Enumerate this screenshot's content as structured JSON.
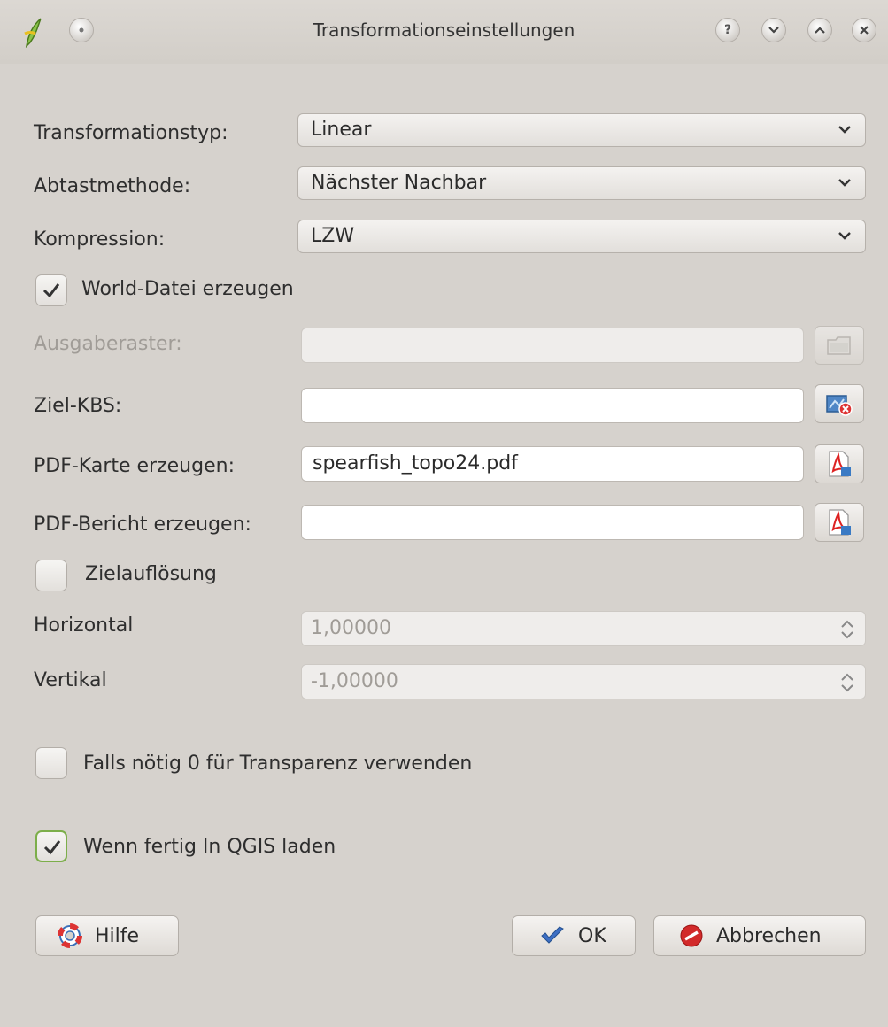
{
  "window": {
    "title": "Transformationseinstellungen",
    "help_glyph": "?",
    "icons": [
      "qgis-logo-icon",
      "pin-icon",
      "help-icon",
      "minimize-icon",
      "maximize-icon",
      "close-icon"
    ]
  },
  "form": {
    "transformation_type": {
      "label": "Transformationstyp:",
      "value": "Linear"
    },
    "resampling": {
      "label": "Abtastmethode:",
      "value": "Nächster Nachbar"
    },
    "compression": {
      "label": "Kompression:",
      "value": "LZW"
    },
    "world_file": {
      "label": "World-Datei erzeugen",
      "checked": true
    },
    "output_raster": {
      "label": "Ausgaberaster:",
      "value": "",
      "enabled": false
    },
    "target_crs": {
      "label": "Ziel-KBS:",
      "value": ""
    },
    "pdf_map": {
      "label": "PDF-Karte erzeugen:",
      "value": "spearfish_topo24.pdf"
    },
    "pdf_report": {
      "label": "PDF-Bericht erzeugen:",
      "value": ""
    },
    "target_resolution": {
      "label": "Zielauflösung",
      "checked": false
    },
    "horizontal": {
      "label": "Horizontal",
      "value": "1,00000",
      "enabled": false
    },
    "vertical": {
      "label": "Vertikal",
      "value": "-1,00000",
      "enabled": false
    },
    "transparency": {
      "label": "Falls nötig 0 für Transparenz verwenden",
      "checked": false
    },
    "load_in_qgis": {
      "label": "Wenn fertig In QGIS laden",
      "checked": true
    }
  },
  "buttons": {
    "help": "Hilfe",
    "ok": "OK",
    "cancel": "Abbrechen"
  },
  "colors": {
    "background": "#d6d2cd",
    "focus_green": "#7cae4a",
    "ok_blue": "#3d6fc4",
    "cancel_red": "#d22a2a"
  }
}
